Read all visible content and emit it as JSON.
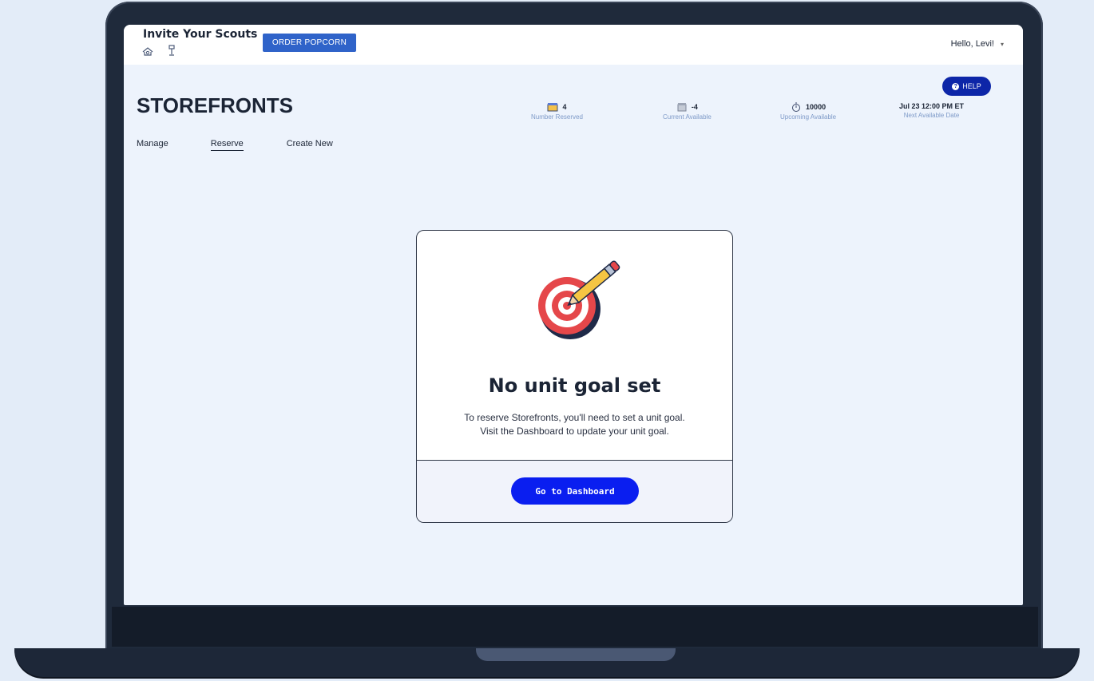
{
  "topbar": {
    "brand_title": "Invite Your Scouts",
    "order_button": "ORDER POPCORN",
    "greeting": "Hello, Levi!"
  },
  "header": {
    "title": "STOREFRONTS",
    "help_label": "HELP",
    "stats": [
      {
        "value": "4",
        "label": "Number Reserved",
        "icon": "storefront-icon"
      },
      {
        "value": "-4",
        "label": "Current Available",
        "icon": "store-available-icon"
      },
      {
        "value": "10000",
        "label": "Upcoming Available",
        "icon": "stopwatch-icon"
      },
      {
        "value": "Jul 23 12:00 PM ET",
        "label": "Next Available Date",
        "icon": ""
      }
    ]
  },
  "nav": {
    "items": [
      "Manage",
      "Reserve",
      "Create New"
    ],
    "active": "Reserve"
  },
  "card": {
    "title": "No unit goal set",
    "line1": "To reserve Storefronts, you'll need to set a unit goal.",
    "line2": "Visit the Dashboard to update your unit goal.",
    "button": "Go to Dashboard"
  },
  "colors": {
    "primary_button": "#0a1ef0",
    "order_button": "#2f63c9",
    "help_button": "#0d26a8",
    "page_bg": "#edf3fc",
    "target_red": "#e5474a"
  }
}
